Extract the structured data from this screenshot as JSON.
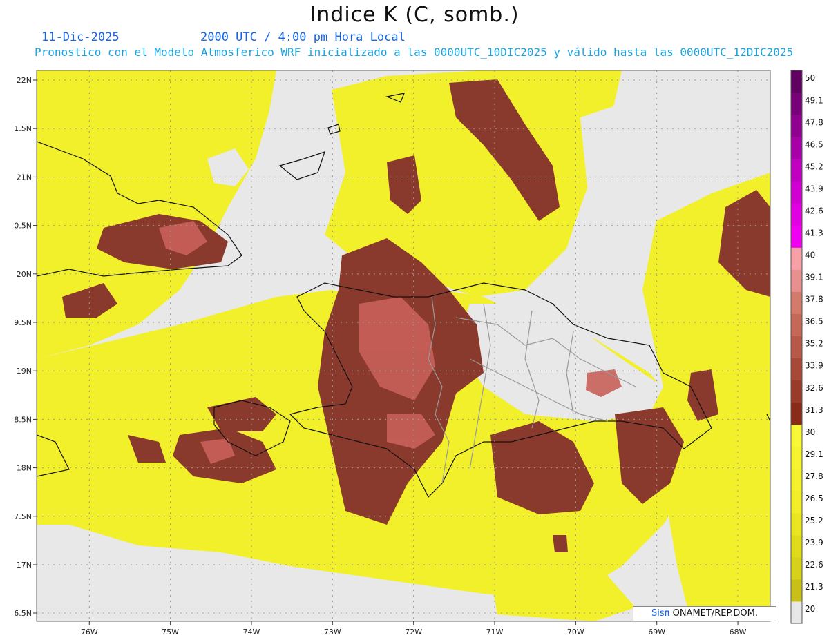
{
  "header": {
    "title": "Indice K (C, somb.)",
    "date": "11-Dic-2025",
    "time": "2000 UTC / 4:00 pm Hora Local",
    "subtitle": "Pronostico con el Modelo Atmosferico WRF inicializado a las 0000UTC_10DIC2025 y válido hasta las  0000UTC_12DIC2025"
  },
  "map": {
    "lon_range": [
      -76.65,
      -67.6
    ],
    "lat_range": [
      6.33,
      22.1
    ],
    "lon_ticks": [
      {
        "value": -76,
        "label": "76W"
      },
      {
        "value": -75,
        "label": "75W"
      },
      {
        "value": -74,
        "label": "74W"
      },
      {
        "value": -73,
        "label": "73W"
      },
      {
        "value": -72,
        "label": "72W"
      },
      {
        "value": -71,
        "label": "71W"
      },
      {
        "value": -70,
        "label": "70W"
      },
      {
        "value": -69,
        "label": "69W"
      },
      {
        "value": -68,
        "label": "68W"
      }
    ],
    "lat_ticks": [
      {
        "value": 22,
        "label": "22N"
      },
      {
        "value": 21.5,
        "label": "1.5N"
      },
      {
        "value": 21,
        "label": "21N"
      },
      {
        "value": 20.5,
        "label": "0.5N"
      },
      {
        "value": 20,
        "label": "20N"
      },
      {
        "value": 19.5,
        "label": "9.5N"
      },
      {
        "value": 19,
        "label": "19N"
      },
      {
        "value": 18.5,
        "label": "8.5N"
      },
      {
        "value": 18,
        "label": "18N"
      },
      {
        "value": 17.5,
        "label": "7.5N"
      },
      {
        "value": 17,
        "label": "17N"
      },
      {
        "value": 6.5,
        "label": "6.5N"
      }
    ],
    "background_color": "#e8e8e8",
    "colors": {
      "low": "#f5f537",
      "mid": "#f0f01e",
      "high": "#8a3a2c",
      "very_high": "#c8605a"
    }
  },
  "colorbar": {
    "levels": [
      "20",
      "21.3",
      "22.6",
      "23.9",
      "25.2",
      "26.5",
      "27.8",
      "29.1",
      "30",
      "31.3",
      "32.6",
      "33.9",
      "35.2",
      "36.5",
      "37.8",
      "39.1",
      "40",
      "41.3",
      "42.6",
      "43.9",
      "45.2",
      "46.5",
      "47.8",
      "49.1",
      "50"
    ],
    "colors": [
      "#e8e8e8",
      "#c8c018",
      "#d6d21a",
      "#e0dc1c",
      "#eae622",
      "#f2ee28",
      "#f4f22c",
      "#f6f430",
      "#f8f838",
      "#8a2a18",
      "#9a3a28",
      "#aa4838",
      "#b85848",
      "#c66858",
      "#d47a6a",
      "#e89090",
      "#f8a0a8",
      "#f000f0",
      "#e000e0",
      "#d000d0",
      "#c000c0",
      "#a800a8",
      "#900090",
      "#780078",
      "#600060"
    ]
  },
  "credit": {
    "brand": "Sisπ",
    "text": " ONAMET/REP.DOM."
  }
}
